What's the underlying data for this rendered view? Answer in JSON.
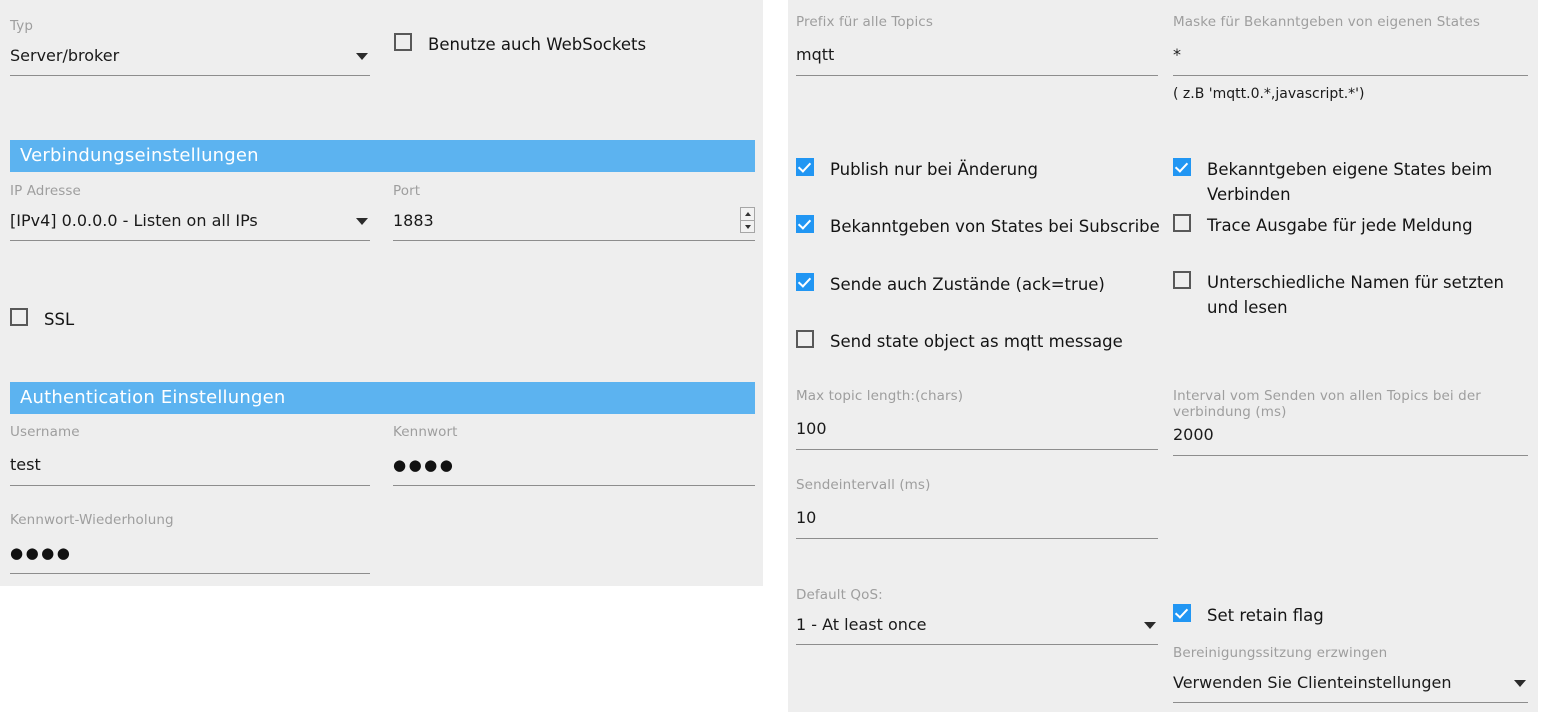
{
  "colors": {
    "panel_bg": "#eeeeee",
    "section_bar": "#5cb3f0",
    "checkbox_checked": "#2196f3",
    "label_grey": "#9e9e9e",
    "underline": "#8d8d8d"
  },
  "left_panel": {
    "type_field": {
      "label": "Typ",
      "value": "Server/broker"
    },
    "websockets_checkbox": {
      "label": "Benutze auch WebSockets",
      "checked": false
    },
    "connection_section": {
      "title": "Verbindungseinstellungen",
      "ip_field": {
        "label": "IP Adresse",
        "value": "[IPv4] 0.0.0.0 - Listen on all IPs"
      },
      "port_field": {
        "label": "Port",
        "value": "1883"
      },
      "ssl_checkbox": {
        "label": "SSL",
        "checked": false
      }
    },
    "auth_section": {
      "title": "Authentication Einstellungen",
      "username_field": {
        "label": "Username",
        "value": "test"
      },
      "password_field": {
        "label": "Kennwort",
        "value": "●●●●"
      },
      "password_repeat_field": {
        "label": "Kennwort-Wiederholung",
        "value": "●●●●"
      }
    }
  },
  "right_panel": {
    "prefix_field": {
      "label": "Prefix für alle Topics",
      "value": "mqtt"
    },
    "mask_field": {
      "label": "Maske für Bekanntgeben von eigenen States",
      "value": "*",
      "hint": "( z.B 'mqtt.0.*,javascript.*')"
    },
    "left_checkboxes": [
      {
        "label": "Publish nur bei Änderung",
        "checked": true
      },
      {
        "label": "Bekanntgeben von States bei Subscribe",
        "checked": true
      },
      {
        "label": "Sende auch Zustände (ack=true)",
        "checked": true
      },
      {
        "label": "Send state object as mqtt message",
        "checked": false
      }
    ],
    "right_checkboxes": [
      {
        "label": "Bekanntgeben eigene States beim Verbinden",
        "checked": true
      },
      {
        "label": "Trace Ausgabe für jede Meldung",
        "checked": false
      },
      {
        "label": "Unterschiedliche Namen für setzten und lesen",
        "checked": false
      }
    ],
    "max_topic_length_field": {
      "label": "Max topic length:(chars)",
      "value": "100"
    },
    "send_interval_field": {
      "label": "Sendeintervall (ms)",
      "value": "10"
    },
    "connect_interval_field": {
      "label": "Interval vom Senden von allen Topics bei der verbindung (ms)",
      "value": "2000"
    },
    "qos_field": {
      "label": "Default QoS:",
      "value": "1 - At least once"
    },
    "retain_checkbox": {
      "label": "Set retain flag",
      "checked": true
    },
    "clean_session_field": {
      "label": "Bereinigungssitzung erzwingen",
      "value": "Verwenden Sie Clienteinstellungen"
    }
  }
}
